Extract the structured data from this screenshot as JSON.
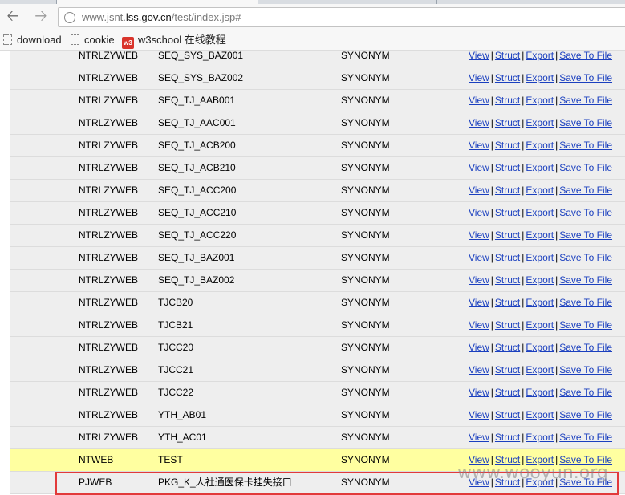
{
  "browser": {
    "url_prefix": "www.jsnt.",
    "url_host": "lss.gov.cn",
    "url_path": "/test/index.jsp#",
    "bookmarks": [
      {
        "label": "download",
        "icon": "page-icon"
      },
      {
        "label": "cookie",
        "icon": "page-icon"
      },
      {
        "label": "w3school 在线教程",
        "icon": "w3school-icon",
        "icon_text": "w3"
      }
    ]
  },
  "actions": {
    "view": "View",
    "struct": "Struct",
    "export": "Export",
    "save": "Save To File",
    "separator": "|"
  },
  "rows": [
    {
      "owner": "NTRLZYWEB",
      "name": "SEQ_SYS_BAZ001",
      "type": "SYNONYM"
    },
    {
      "owner": "NTRLZYWEB",
      "name": "SEQ_SYS_BAZ002",
      "type": "SYNONYM"
    },
    {
      "owner": "NTRLZYWEB",
      "name": "SEQ_TJ_AAB001",
      "type": "SYNONYM"
    },
    {
      "owner": "NTRLZYWEB",
      "name": "SEQ_TJ_AAC001",
      "type": "SYNONYM"
    },
    {
      "owner": "NTRLZYWEB",
      "name": "SEQ_TJ_ACB200",
      "type": "SYNONYM"
    },
    {
      "owner": "NTRLZYWEB",
      "name": "SEQ_TJ_ACB210",
      "type": "SYNONYM"
    },
    {
      "owner": "NTRLZYWEB",
      "name": "SEQ_TJ_ACC200",
      "type": "SYNONYM"
    },
    {
      "owner": "NTRLZYWEB",
      "name": "SEQ_TJ_ACC210",
      "type": "SYNONYM"
    },
    {
      "owner": "NTRLZYWEB",
      "name": "SEQ_TJ_ACC220",
      "type": "SYNONYM"
    },
    {
      "owner": "NTRLZYWEB",
      "name": "SEQ_TJ_BAZ001",
      "type": "SYNONYM"
    },
    {
      "owner": "NTRLZYWEB",
      "name": "SEQ_TJ_BAZ002",
      "type": "SYNONYM"
    },
    {
      "owner": "NTRLZYWEB",
      "name": "TJCB20",
      "type": "SYNONYM"
    },
    {
      "owner": "NTRLZYWEB",
      "name": "TJCB21",
      "type": "SYNONYM"
    },
    {
      "owner": "NTRLZYWEB",
      "name": "TJCC20",
      "type": "SYNONYM"
    },
    {
      "owner": "NTRLZYWEB",
      "name": "TJCC21",
      "type": "SYNONYM"
    },
    {
      "owner": "NTRLZYWEB",
      "name": "TJCC22",
      "type": "SYNONYM"
    },
    {
      "owner": "NTRLZYWEB",
      "name": "YTH_AB01",
      "type": "SYNONYM"
    },
    {
      "owner": "NTRLZYWEB",
      "name": "YTH_AC01",
      "type": "SYNONYM"
    },
    {
      "owner": "NTWEB",
      "name": "TEST",
      "type": "SYNONYM",
      "highlighted": true
    },
    {
      "owner": "PJWEB",
      "name": "PKG_K_人社通医保卡挂失接口",
      "type": "SYNONYM",
      "selected": true
    }
  ],
  "watermark": "www.wooyun.org",
  "colors": {
    "row_bg": "#eeeeee",
    "highlight_bg": "#ffffa0",
    "link": "#1a3fbf",
    "selection_border": "#e23a3a"
  }
}
